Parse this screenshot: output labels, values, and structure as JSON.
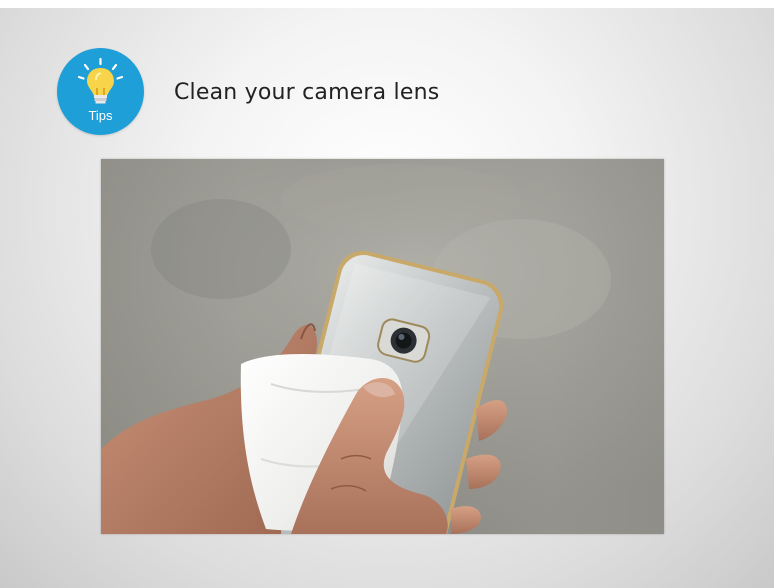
{
  "slide": {
    "title": "Clean your camera lens",
    "badge": {
      "label": "Tips",
      "icon": "lightbulb-icon",
      "color": "#1f9fd8"
    },
    "photo": {
      "subject": "hands-cleaning-phone-camera-photo"
    }
  }
}
